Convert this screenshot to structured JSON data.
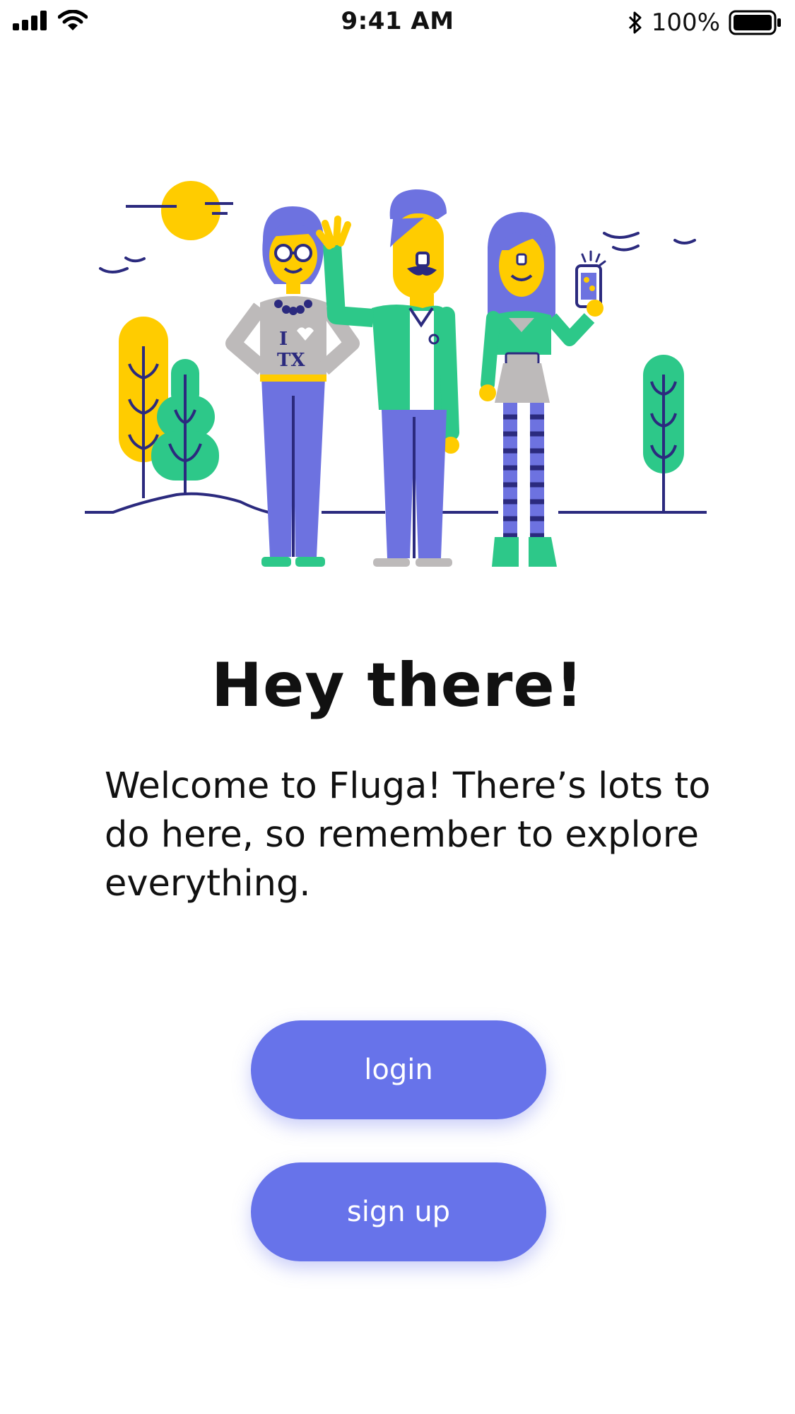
{
  "status_bar": {
    "time": "9:41 AM",
    "battery_percent": "100%",
    "icons": [
      "signal-icon",
      "wifi-icon",
      "bluetooth-icon",
      "battery-icon"
    ]
  },
  "illustration": {
    "shirt_text_top": "I",
    "shirt_text_bottom": "TX"
  },
  "welcome": {
    "title": "Hey there!",
    "message": "Welcome to Fluga! There’s lots to do here, so remember to explore everything."
  },
  "actions": {
    "login_label": "login",
    "signup_label": "sign up"
  },
  "colors": {
    "accent": "#6773EA",
    "yellow": "#FFCC00",
    "green": "#2DC889",
    "purple": "#6D72E0",
    "navy": "#2B2A7E"
  }
}
